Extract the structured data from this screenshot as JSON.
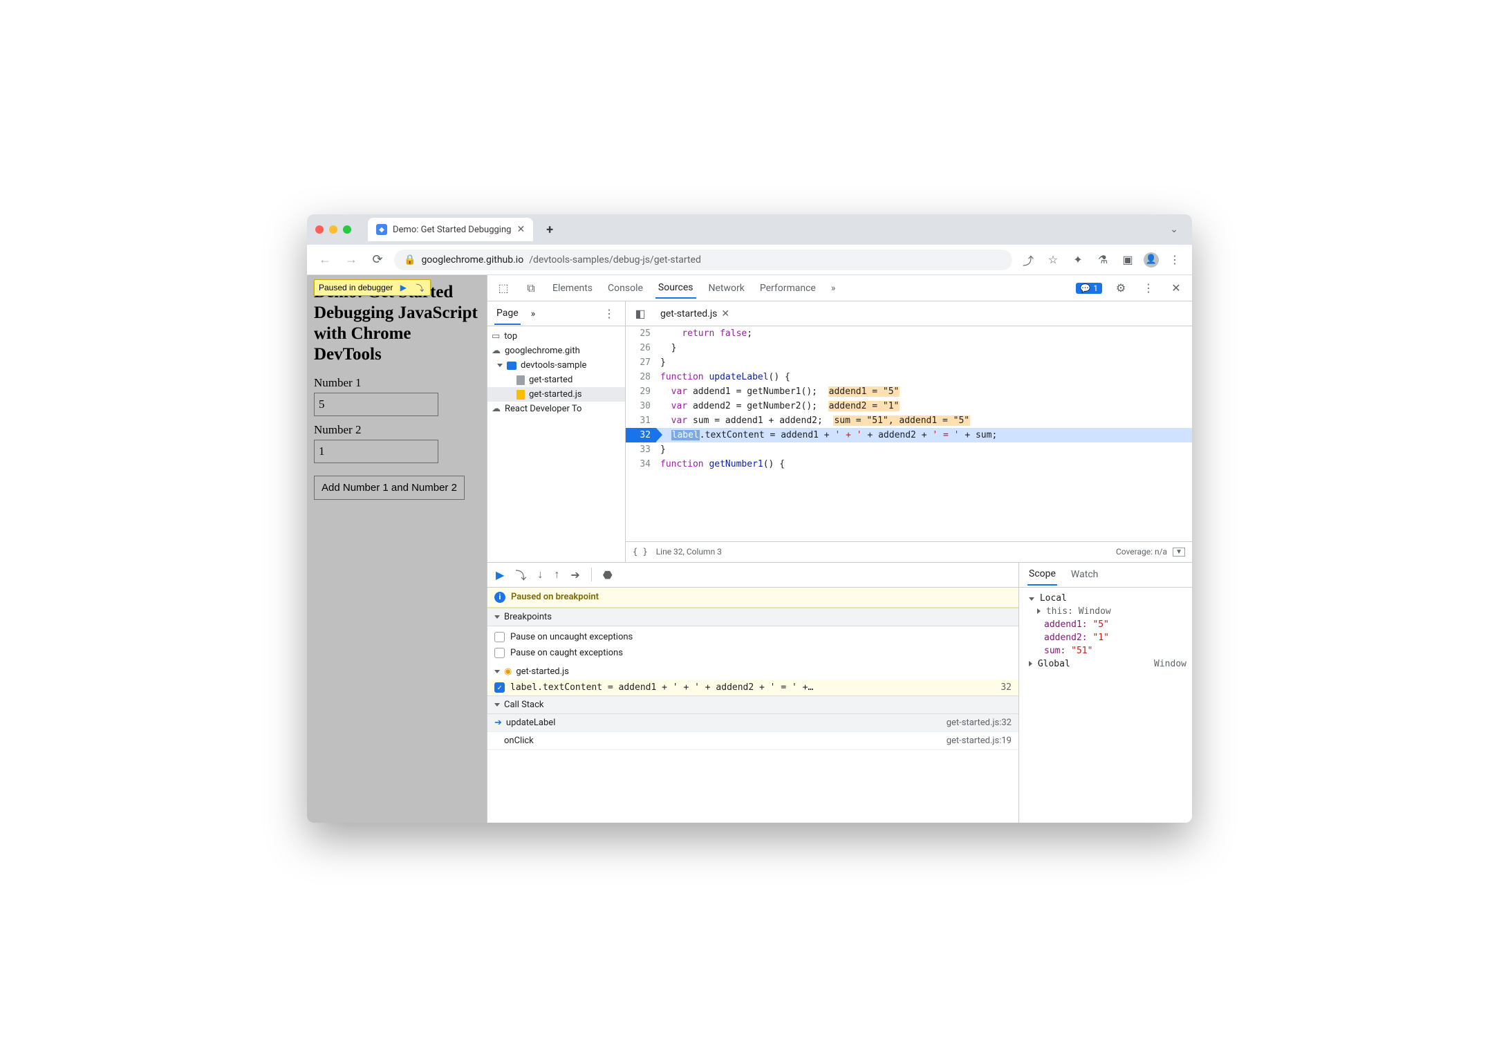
{
  "browser": {
    "tab_title": "Demo: Get Started Debugging",
    "url_host": "googlechrome.github.io",
    "url_path": "/devtools-samples/debug-js/get-started"
  },
  "page": {
    "paused_label": "Paused in debugger",
    "heading": "Demo: Get Started Debugging JavaScript with Chrome DevTools",
    "num1_label": "Number 1",
    "num1_value": "5",
    "num2_label": "Number 2",
    "num2_value": "1",
    "add_button": "Add Number 1 and Number 2"
  },
  "devtools": {
    "panels": [
      "Elements",
      "Console",
      "Sources",
      "Network",
      "Performance"
    ],
    "active_panel": "Sources",
    "message_count": "1"
  },
  "filetree": {
    "tab": "Page",
    "top": "top",
    "cloud": "googlechrome.gith",
    "folder": "devtools-sample",
    "file_html": "get-started",
    "file_js": "get-started.js",
    "ext": "React Developer To"
  },
  "editor": {
    "open_file": "get-started.js",
    "bp_line": 32,
    "status_line": "Line 32, Column 3",
    "coverage": "Coverage: n/a",
    "lines": {
      "25": "    return false;",
      "26": "  }",
      "27": "}",
      "28": "function updateLabel() {",
      "29": "  var addend1 = getNumber1();",
      "29_hint": "addend1 = \"5\"",
      "30": "  var addend2 = getNumber2();",
      "30_hint": "addend2 = \"1\"",
      "31": "  var sum = addend1 + addend2;",
      "31_hint": "sum = \"51\", addend1 = \"5\"",
      "32": "  label.textContent = addend1 + ' + ' + addend2 + ' = ' + sum;",
      "33": "}",
      "34": "function getNumber1() {"
    }
  },
  "debugger": {
    "paused": "Paused on breakpoint",
    "section_bp": "Breakpoints",
    "bp_uncaught": "Pause on uncaught exceptions",
    "bp_caught": "Pause on caught exceptions",
    "bp_file": "get-started.js",
    "bp_code": "label.textContent = addend1 + ' + ' + addend2 + ' = ' +…",
    "bp_line": "32",
    "section_cs": "Call Stack",
    "cs": [
      {
        "fn": "updateLabel",
        "loc": "get-started.js:32",
        "active": true
      },
      {
        "fn": "onClick",
        "loc": "get-started.js:19",
        "active": false
      }
    ]
  },
  "scope": {
    "tabs": [
      "Scope",
      "Watch"
    ],
    "local_label": "Local",
    "this_label": "this:",
    "this_val": "Window",
    "vars": [
      {
        "k": "addend1:",
        "v": "\"5\""
      },
      {
        "k": "addend2:",
        "v": "\"1\""
      },
      {
        "k": "sum:",
        "v": "\"51\""
      }
    ],
    "global_label": "Global",
    "global_val": "Window"
  }
}
